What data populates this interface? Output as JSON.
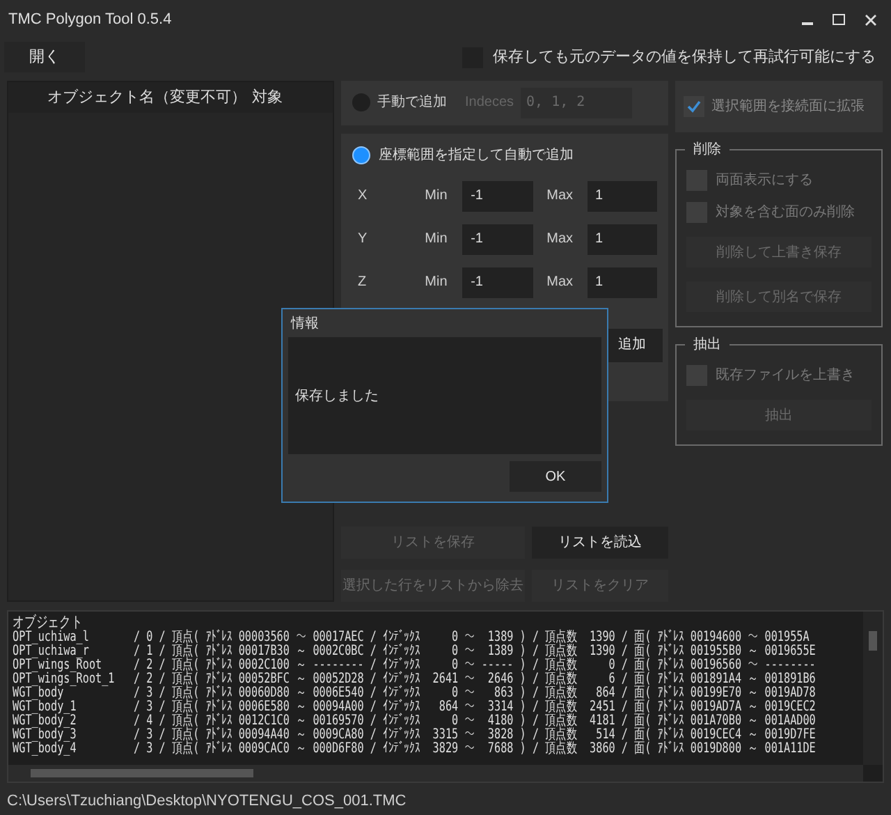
{
  "window": {
    "title": "TMC Polygon Tool 0.5.4"
  },
  "open_button": {
    "label": "開く"
  },
  "keep_original": {
    "label": "保存しても元のデータの値を保持して再試行可能にする",
    "checked": false
  },
  "object_list": {
    "columns": [
      "オブジェクト名（変更不可）",
      "対象"
    ]
  },
  "manual_add": {
    "label": "手動で追加",
    "selected": false,
    "indices_label": "Indeces",
    "indices_value": "0, 1, 2",
    "disabled": true
  },
  "auto_add": {
    "label": "座標範囲を指定して自動で追加",
    "selected": true,
    "axes": [
      {
        "axis": "X",
        "min_label": "Min",
        "min": "-1",
        "max_label": "Max",
        "max": "1"
      },
      {
        "axis": "Y",
        "min_label": "Min",
        "min": "-1",
        "max_label": "Max",
        "max": "1"
      },
      {
        "axis": "Z",
        "min_label": "Min",
        "min": "-1",
        "max_label": "Max",
        "max": "1"
      }
    ],
    "add_button": "追加"
  },
  "expand_selection": {
    "label": "選択範囲を接続面に拡張",
    "checked": true,
    "disabled": true
  },
  "groups": [
    {
      "title": "削除",
      "options": [
        {
          "label": "両面表示にする",
          "checked": false,
          "disabled": true
        },
        {
          "label": "対象を含む面のみ削除",
          "checked": false,
          "disabled": true
        }
      ],
      "buttons": [
        {
          "label": "削除して上書き保存",
          "disabled": true
        },
        {
          "label": "削除して別名で保存",
          "disabled": true
        }
      ]
    },
    {
      "title": "抽出",
      "options": [
        {
          "label": "既存ファイルを上書き",
          "checked": false,
          "disabled": true
        }
      ],
      "buttons": [
        {
          "label": "抽出",
          "disabled": true
        }
      ]
    }
  ],
  "list_buttons": [
    {
      "label": "リストを保存",
      "disabled": true
    },
    {
      "label": "リストを読込",
      "disabled": false
    },
    {
      "label": "選択した行をリストから除去",
      "disabled": true
    },
    {
      "label": "リストをクリア",
      "disabled": true
    }
  ],
  "dialog": {
    "title": "情報",
    "message": "保存しました",
    "ok": "OK"
  },
  "log": {
    "header": "オブジェクト",
    "lines": [
      "OPT_uchiwa_l       / 0 / 頂点( ｱﾄﾞﾚｽ 00003560 ～ 00017AEC / ｲﾝﾃﾞｯｸｽ     0 ～  1389 ) / 頂点数  1390 / 面( ｱﾄﾞﾚｽ 00194600 ～ 001955A",
      "OPT_uchiwa_r       / 1 / 頂点( ｱﾄﾞﾚｽ 00017B30 ～ 0002C0BC / ｲﾝﾃﾞｯｸｽ     0 ～  1389 ) / 頂点数  1390 / 面( ｱﾄﾞﾚｽ 001955B0 ～ 0019655E",
      "OPT_wings_Root     / 2 / 頂点( ｱﾄﾞﾚｽ 0002C100 ～ -------- / ｲﾝﾃﾞｯｸｽ     0 ～ ----- ) / 頂点数     0 / 面( ｱﾄﾞﾚｽ 00196560 ～ --------",
      "OPT_wings_Root_1   / 2 / 頂点( ｱﾄﾞﾚｽ 00052BFC ～ 00052D28 / ｲﾝﾃﾞｯｸｽ  2641 ～  2646 ) / 頂点数     6 / 面( ｱﾄﾞﾚｽ 001891A4 ～ 001891B6",
      "WGT_body           / 3 / 頂点( ｱﾄﾞﾚｽ 00060D80 ～ 0006E540 / ｲﾝﾃﾞｯｸｽ     0 ～   863 ) / 頂点数   864 / 面( ｱﾄﾞﾚｽ 00199E70 ～ 0019AD78",
      "WGT_body_1         / 3 / 頂点( ｱﾄﾞﾚｽ 0006E580 ～ 00094A00 / ｲﾝﾃﾞｯｸｽ   864 ～  3314 ) / 頂点数  2451 / 面( ｱﾄﾞﾚｽ 0019AD7A ～ 0019CEC2",
      "WGT_body_2         / 4 / 頂点( ｱﾄﾞﾚｽ 0012C1C0 ～ 00169570 / ｲﾝﾃﾞｯｸｽ     0 ～  4180 ) / 頂点数  4181 / 面( ｱﾄﾞﾚｽ 001A70B0 ～ 001AAD00",
      "WGT_body_3         / 3 / 頂点( ｱﾄﾞﾚｽ 00094A40 ～ 0009CA80 / ｲﾝﾃﾞｯｸｽ  3315 ～  3828 ) / 頂点数   514 / 面( ｱﾄﾞﾚｽ 0019CEC4 ～ 0019D7FE",
      "WGT_body_4         / 3 / 頂点( ｱﾄﾞﾚｽ 0009CAC0 ～ 000D6F80 / ｲﾝﾃﾞｯｸｽ  3829 ～  7688 ) / 頂点数  3860 / 面( ｱﾄﾞﾚｽ 0019D800 ～ 001A11DE"
    ]
  },
  "status_path": "C:\\Users\\Tzuchiang\\Desktop\\NYOTENGU_COS_001.TMC"
}
